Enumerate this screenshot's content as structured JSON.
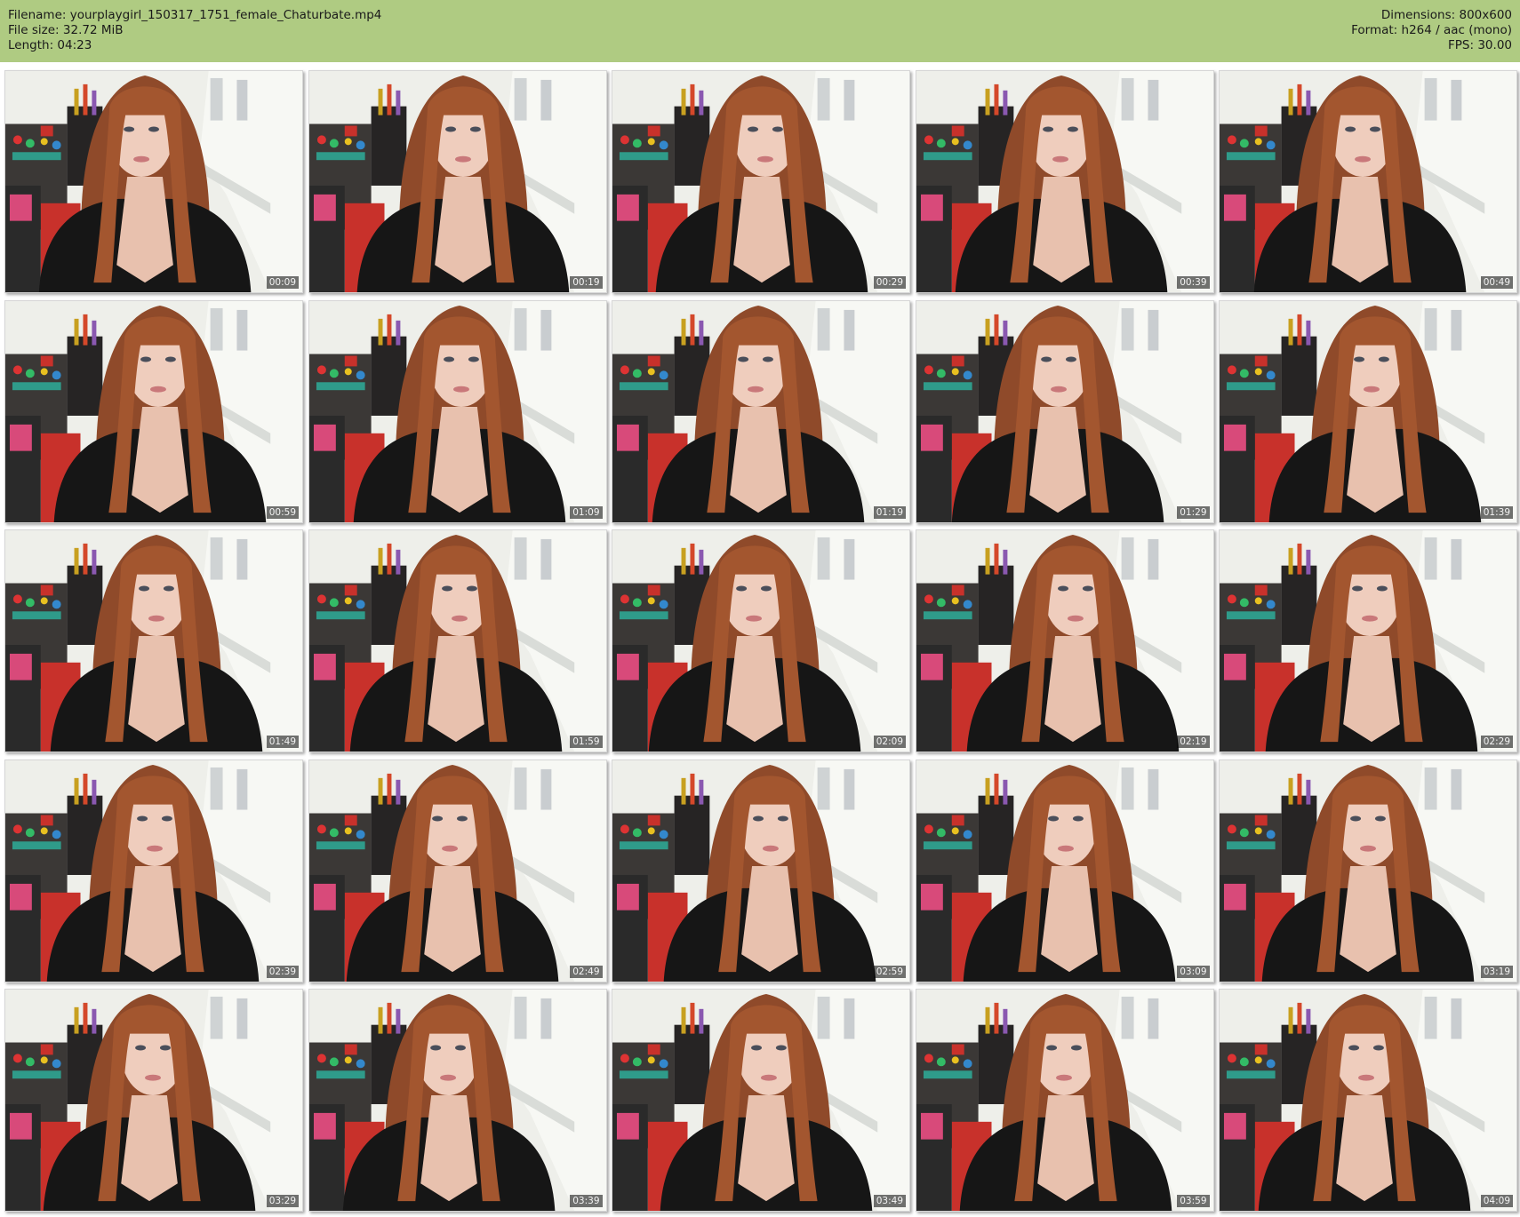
{
  "header": {
    "filename_line": "Filename: yourplaygirl_150317_1751_female_Chaturbate.mp4",
    "filesize_line": "File size: 32.72 MiB",
    "length_line": "Length: 04:23",
    "dimensions_line": "Dimensions: 800x600",
    "format_line": "Format: h264 / aac (mono)",
    "fps_line": "FPS: 30.00"
  },
  "colors": {
    "header_bg": "#afcb82",
    "shirt": "#161616",
    "hair": "#8f4a2a",
    "wall": "#eeefea",
    "chair": "#c8312b"
  },
  "thumbnails": [
    {
      "timestamp": "00:09"
    },
    {
      "timestamp": "00:19"
    },
    {
      "timestamp": "00:29"
    },
    {
      "timestamp": "00:39"
    },
    {
      "timestamp": "00:49"
    },
    {
      "timestamp": "00:59"
    },
    {
      "timestamp": "01:09"
    },
    {
      "timestamp": "01:19"
    },
    {
      "timestamp": "01:29"
    },
    {
      "timestamp": "01:39"
    },
    {
      "timestamp": "01:49"
    },
    {
      "timestamp": "01:59"
    },
    {
      "timestamp": "02:09"
    },
    {
      "timestamp": "02:19"
    },
    {
      "timestamp": "02:29"
    },
    {
      "timestamp": "02:39"
    },
    {
      "timestamp": "02:49"
    },
    {
      "timestamp": "02:59"
    },
    {
      "timestamp": "03:09"
    },
    {
      "timestamp": "03:19"
    },
    {
      "timestamp": "03:29"
    },
    {
      "timestamp": "03:39"
    },
    {
      "timestamp": "03:49"
    },
    {
      "timestamp": "03:59"
    },
    {
      "timestamp": "04:09"
    }
  ]
}
